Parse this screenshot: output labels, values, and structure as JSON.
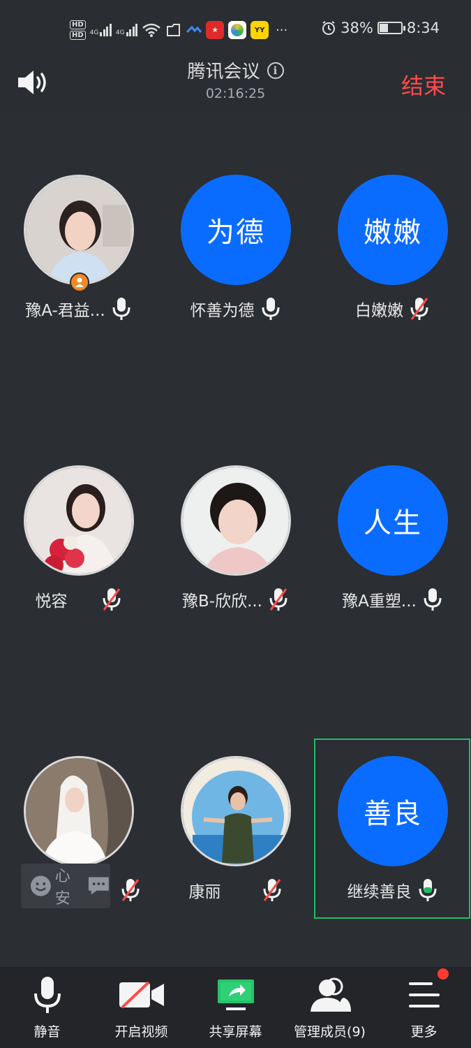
{
  "status_bar": {
    "hd1": "HD",
    "hd2": "HD",
    "net1": "4G",
    "net2": "4G",
    "app_yy": "YY",
    "more": "···",
    "battery": "38%",
    "time": "8:34"
  },
  "header": {
    "title": "腾讯会议",
    "timer": "02:16:25",
    "end_label": "结束"
  },
  "participants": [
    {
      "name": "豫A-君益...",
      "avatar_text": "",
      "mic": "on",
      "photo": true
    },
    {
      "name": "怀善为德",
      "avatar_text": "为德",
      "mic": "on",
      "photo": false
    },
    {
      "name": "白嫩嫩",
      "avatar_text": "嫩嫩",
      "mic": "muted",
      "photo": false
    },
    {
      "name": "悦容",
      "avatar_text": "",
      "mic": "muted",
      "photo": true
    },
    {
      "name": "豫B-欣欣...",
      "avatar_text": "",
      "mic": "muted",
      "photo": true
    },
    {
      "name": "豫A重塑...",
      "avatar_text": "人生",
      "mic": "on",
      "photo": false
    },
    {
      "name": "",
      "avatar_text": "",
      "mic": "muted",
      "photo": true
    },
    {
      "name": "康丽",
      "avatar_text": "",
      "mic": "muted",
      "photo": true
    },
    {
      "name": "继续善良",
      "avatar_text": "善良",
      "mic": "speaking",
      "photo": false
    }
  ],
  "chat_overlay": {
    "text": "心安"
  },
  "toolbar": {
    "mute": "静音",
    "video": "开启视频",
    "share": "共享屏幕",
    "members": "管理成员(9)",
    "more": "更多"
  },
  "colors": {
    "accent_blue": "#0a6cff",
    "end_red": "#ff4b4b",
    "speaking_green": "#1fbf64",
    "host_orange": "#f08a24",
    "share_green": "#27c46a"
  }
}
